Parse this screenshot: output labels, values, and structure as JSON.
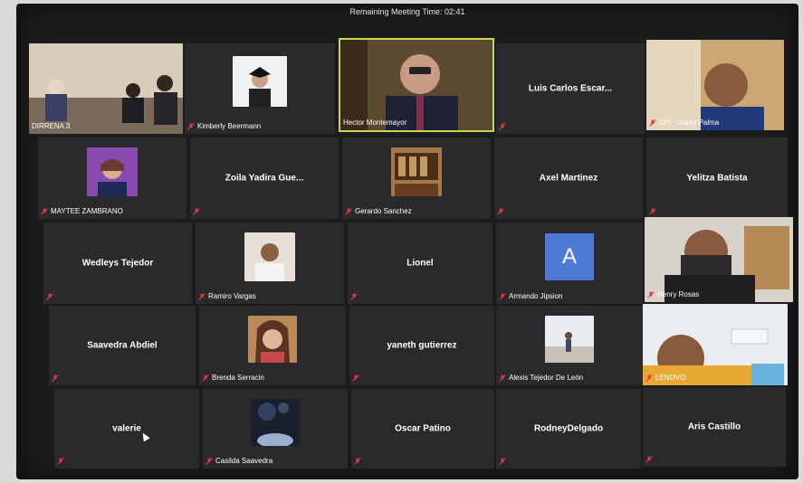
{
  "meeting": {
    "remaining_time_text": "Remaining Meeting Time: 02:41"
  },
  "participants": [
    {
      "name": "DIRRENA 3",
      "video": true
    },
    {
      "name": "Kimberly Beermann",
      "video": true
    },
    {
      "name": "Hector Montemayor",
      "video": true,
      "active": true
    },
    {
      "name": "Luis Carlos Escar...",
      "video": false
    },
    {
      "name": "DPI - Julián Palma",
      "video": true
    },
    {
      "name": "MAYTEE ZAMBRANO",
      "video": true
    },
    {
      "name": "Zoila Yadira Gue...",
      "video": false
    },
    {
      "name": "Gerardo Sanchez",
      "video": true
    },
    {
      "name": "Axel Martinez",
      "video": false
    },
    {
      "name": "Yelitza Batista",
      "video": false
    },
    {
      "name": "Wedleys Tejedor",
      "video": false
    },
    {
      "name": "Ramiro Vargas",
      "video": true
    },
    {
      "name": "Lionel",
      "video": false
    },
    {
      "name": "Armando Jipsion",
      "video": true,
      "avatar_letter": "A"
    },
    {
      "name": "Henry Rosas",
      "video": true
    },
    {
      "name": "Saavedra Abdiel",
      "video": false
    },
    {
      "name": "Brenda Serracin",
      "video": true
    },
    {
      "name": "yaneth gutierrez",
      "video": false
    },
    {
      "name": "Alexis Tejedor De León",
      "video": true
    },
    {
      "name": "LENOVO",
      "video": true
    },
    {
      "name": "valerie",
      "video": false
    },
    {
      "name": "Casilda Saavedra",
      "video": true
    },
    {
      "name": "Oscar Patino",
      "video": false
    },
    {
      "name": "RodneyDelgado",
      "video": false
    },
    {
      "name": "Aris Castillo",
      "video": false
    }
  ],
  "colors": {
    "tile_bg": "#2a2a2c",
    "active_border": "#c8d84a",
    "mute_icon": "#e03a3a",
    "avatar_blue": "#4e7ad6"
  }
}
